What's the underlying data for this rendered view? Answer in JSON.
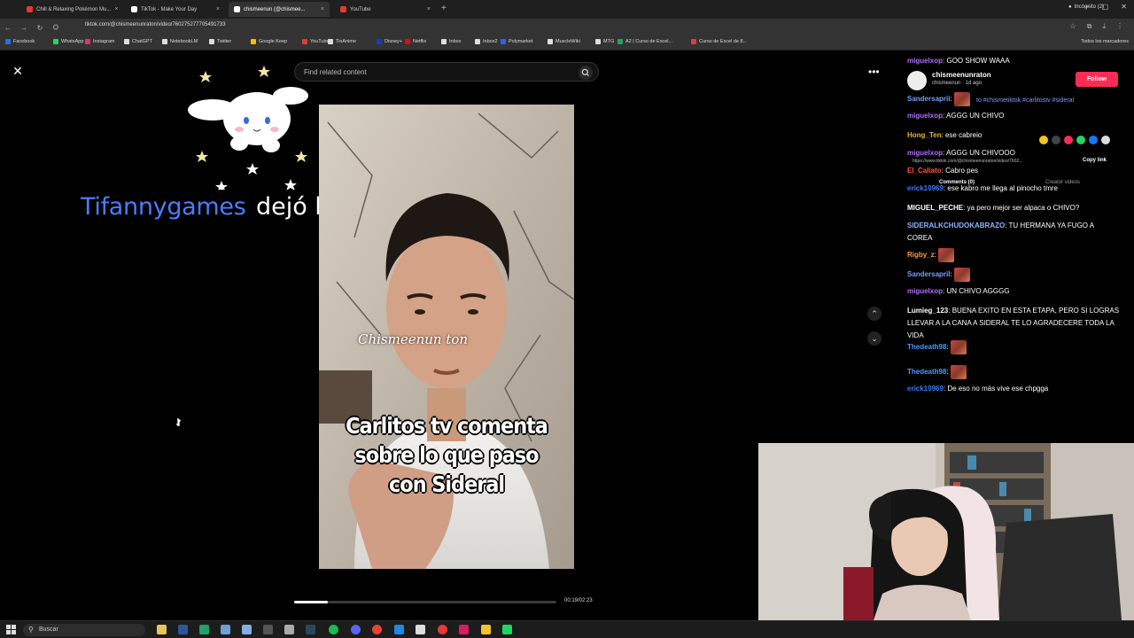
{
  "browser": {
    "tabs": [
      {
        "title": "Chill & Relaxing Pokémon Mu...",
        "color": "#e53935"
      },
      {
        "title": "TikTok - Make Your Day",
        "color": "#111111"
      },
      {
        "title": "chismeenun (@chismee...",
        "color": "#111111"
      },
      {
        "title": "YouTube",
        "color": "#e53935"
      }
    ],
    "incognito_label": "Incógnito (2)",
    "url": "tiktok.com/@chismeenunraton/video/760275277705491733",
    "bookmarks": [
      {
        "label": "Facebook",
        "color": "#1877f2"
      },
      {
        "label": "WhatsApp",
        "color": "#25d366"
      },
      {
        "label": "Instagram",
        "color": "#e1306c"
      },
      {
        "label": "ChatGPT",
        "color": "#dddddd"
      },
      {
        "label": "NotebookLM",
        "color": "#dddddd"
      },
      {
        "label": "Twitter",
        "color": "#dddddd"
      },
      {
        "label": "Google Keep",
        "color": "#fbbc04"
      },
      {
        "label": "YouTube",
        "color": "#e53935"
      },
      {
        "label": "TioAnime",
        "color": "#dddddd"
      },
      {
        "label": "Disney+",
        "color": "#113ccf"
      },
      {
        "label": "Netflix",
        "color": "#e50914"
      },
      {
        "label": "Inbox",
        "color": "#dddddd"
      },
      {
        "label": "Inbox2",
        "color": "#dddddd"
      },
      {
        "label": "Polymarket",
        "color": "#2e5cff"
      },
      {
        "label": "MuscleWiki",
        "color": "#dddddd"
      },
      {
        "label": "MTG",
        "color": "#dddddd"
      },
      {
        "label": "A2 | Curso de Excel...",
        "color": "#21a366"
      },
      {
        "label": "Curso de Excel de 8...",
        "color": "#e53935"
      }
    ],
    "all_bookmarks": "Todos los marcadores"
  },
  "tiktok": {
    "search_placeholder": "Find related content",
    "caption": "Carlitos tv comenta\nsobre lo que paso\ncon Sideral",
    "watermark": "Chismeenun ton",
    "time": "00:19/02:23",
    "progress": 0.13,
    "card": {
      "username": "chismeenunraton",
      "subtitle": "chismeenun · 1d ago",
      "follow": "Follow",
      "tags": "to #chismetiktok #carlitostv #sideral",
      "link": "https://www.tiktok.com/@chismeenunraton/video/7602...",
      "copy_link": "Copy link",
      "tab_comments": "Comments (0)",
      "tab_creator": "Creator videos"
    }
  },
  "stream_overlay": {
    "name": "Tifannygames",
    "message": "dejó bien owo"
  },
  "chat": [
    {
      "user": "miguelxop",
      "color": "#b36cff",
      "text": "GOO SHOW WAAA",
      "emote": false
    },
    {
      "user": "Sandersaprii",
      "color": "#7a9bff",
      "text": "",
      "emote": true
    },
    {
      "user": "miguelxop",
      "color": "#b36cff",
      "text": "AGGG UN CHIVO",
      "emote": false
    },
    {
      "user": "Hong_Ten",
      "color": "#e5b53a",
      "text": "ese cabreio",
      "emote": false
    },
    {
      "user": "miguelxop",
      "color": "#b36cff",
      "text": "AGGG UN CHIVOOO",
      "emote": false
    },
    {
      "user": "El_Caliato",
      "color": "#ff5a3a",
      "text": "Cabro pes",
      "emote": false
    },
    {
      "user": "erick10969",
      "color": "#3a7bff",
      "text": "ese kabro me llega al pinocho tmre",
      "emote": false
    },
    {
      "user": "MIGUEL_PECHE",
      "color": "#ffffff",
      "text": "ya pero mejor ser alpaca o CHIVO?",
      "emote": false
    },
    {
      "user": "SIDERALKCHUDOKABRAZO",
      "color": "#8fb4ff",
      "text": "TU HERMANA YA FUGO A COREA",
      "emote": false
    },
    {
      "user": "Rigby_z",
      "color": "#ff9f2e",
      "text": "",
      "emote": true
    },
    {
      "user": "Sandersapril",
      "color": "#7a9bff",
      "text": "",
      "emote": true
    },
    {
      "user": "miguelxop",
      "color": "#b36cff",
      "text": "UN CHIVO AGGGG",
      "emote": false
    },
    {
      "user": "Lumieg_123",
      "color": "#ffffff",
      "text": "BUENA EXITO EN ESTA ETAPA, PERO SI LOGRAS LLEVAR A LA CANA A SIDERAL TE LO AGRADECERE TODA LA VIDA",
      "emote": false
    },
    {
      "user": "Thedeath98",
      "color": "#4a9bff",
      "text": "",
      "emote": true
    },
    {
      "user": "Thedeath98",
      "color": "#4a9bff",
      "text": "",
      "emote": true
    },
    {
      "user": "erick10969",
      "color": "#3a7bff",
      "text": "De eso no más vive ese chpgga",
      "emote": false
    }
  ],
  "taskbar": {
    "search": "Buscar"
  }
}
